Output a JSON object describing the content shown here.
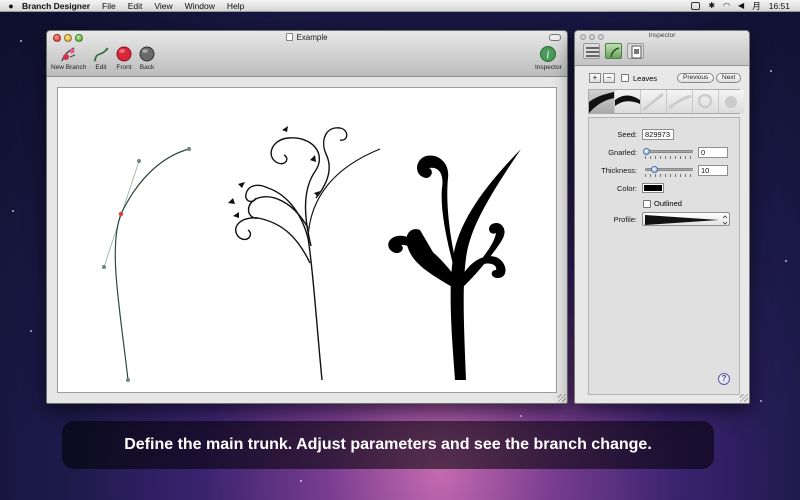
{
  "menubar": {
    "app_name": "Branch Designer",
    "menus": [
      "File",
      "Edit",
      "View",
      "Window",
      "Help"
    ],
    "ime_label": "月",
    "clock": "16:51"
  },
  "document": {
    "title": "Example",
    "toolbar": {
      "new_branch": "New Branch",
      "edit": "Edit",
      "front": "Front",
      "back": "Back",
      "inspector": "Inspector"
    }
  },
  "inspector": {
    "title": "Inspector",
    "add": "+",
    "remove": "−",
    "leaves_label": "Leaves",
    "leaves_checked": false,
    "previous": "Previous",
    "next": "Next",
    "seed_label": "Seed:",
    "seed_value": "829973",
    "gnarled_label": "Gnarled:",
    "gnarled_value": "0",
    "gnarled_level": 0.0,
    "thickness_label": "Thickness:",
    "thickness_value": "10",
    "thickness_level": 0.18,
    "color_label": "Color:",
    "color_value": "#000000",
    "outlined_label": "Outlined",
    "outlined_checked": false,
    "profile_label": "Profile:",
    "help": "?"
  },
  "caption": "Define the main trunk. Adjust parameters and see the branch change."
}
